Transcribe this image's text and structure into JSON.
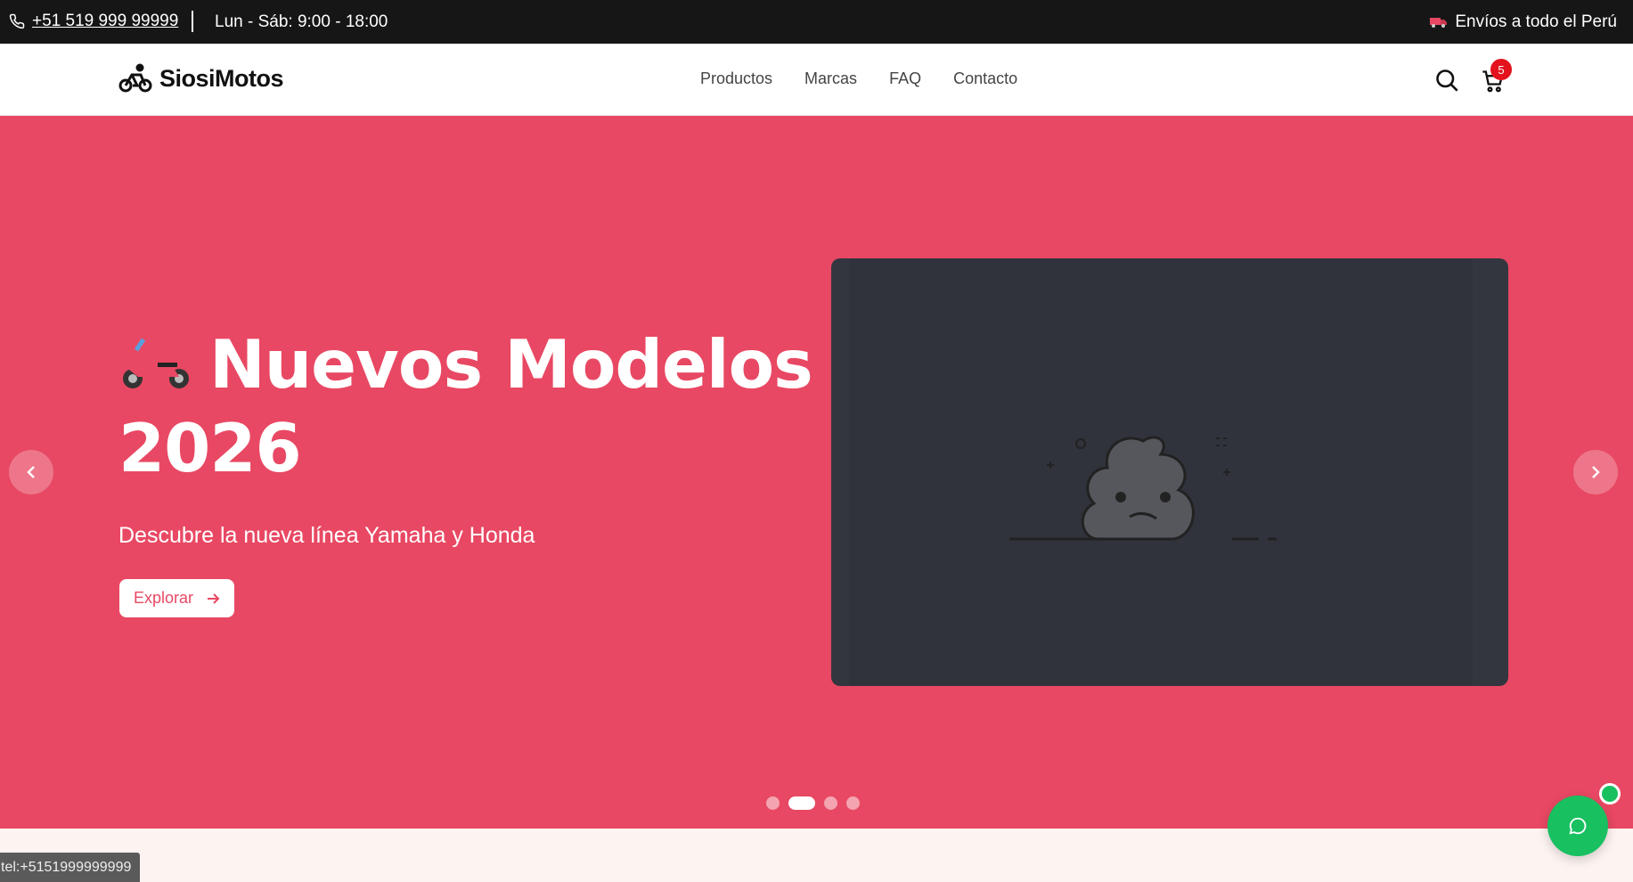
{
  "topbar": {
    "phone": "+51 519 999 99999",
    "hours": "Lun - Sáb: 9:00 - 18:00",
    "shipping": "Envíos a todo el Perú",
    "shipping_icon": "truck-icon",
    "phone_icon": "phone-icon"
  },
  "header": {
    "brand": "SiosiMotos",
    "logo_icon": "bicycle-icon",
    "nav": [
      "Productos",
      "Marcas",
      "FAQ",
      "Contacto"
    ],
    "cart_count": "5"
  },
  "hero": {
    "title_line1": "Nuevos Modelos",
    "title_line2": "2026",
    "title_icon": "motor-scooter-emoji",
    "subtitle": "Descubre la nueva línea Yamaha y Honda",
    "cta_label": "Explorar",
    "image_icon": "broken-image-poo-icon",
    "slides_total": 4,
    "active_slide": 2,
    "background_color": "#e84863"
  },
  "chat": {
    "icon": "chat-bubble-icon",
    "color": "#18c060"
  },
  "status_url": "tel:+5151999999999"
}
